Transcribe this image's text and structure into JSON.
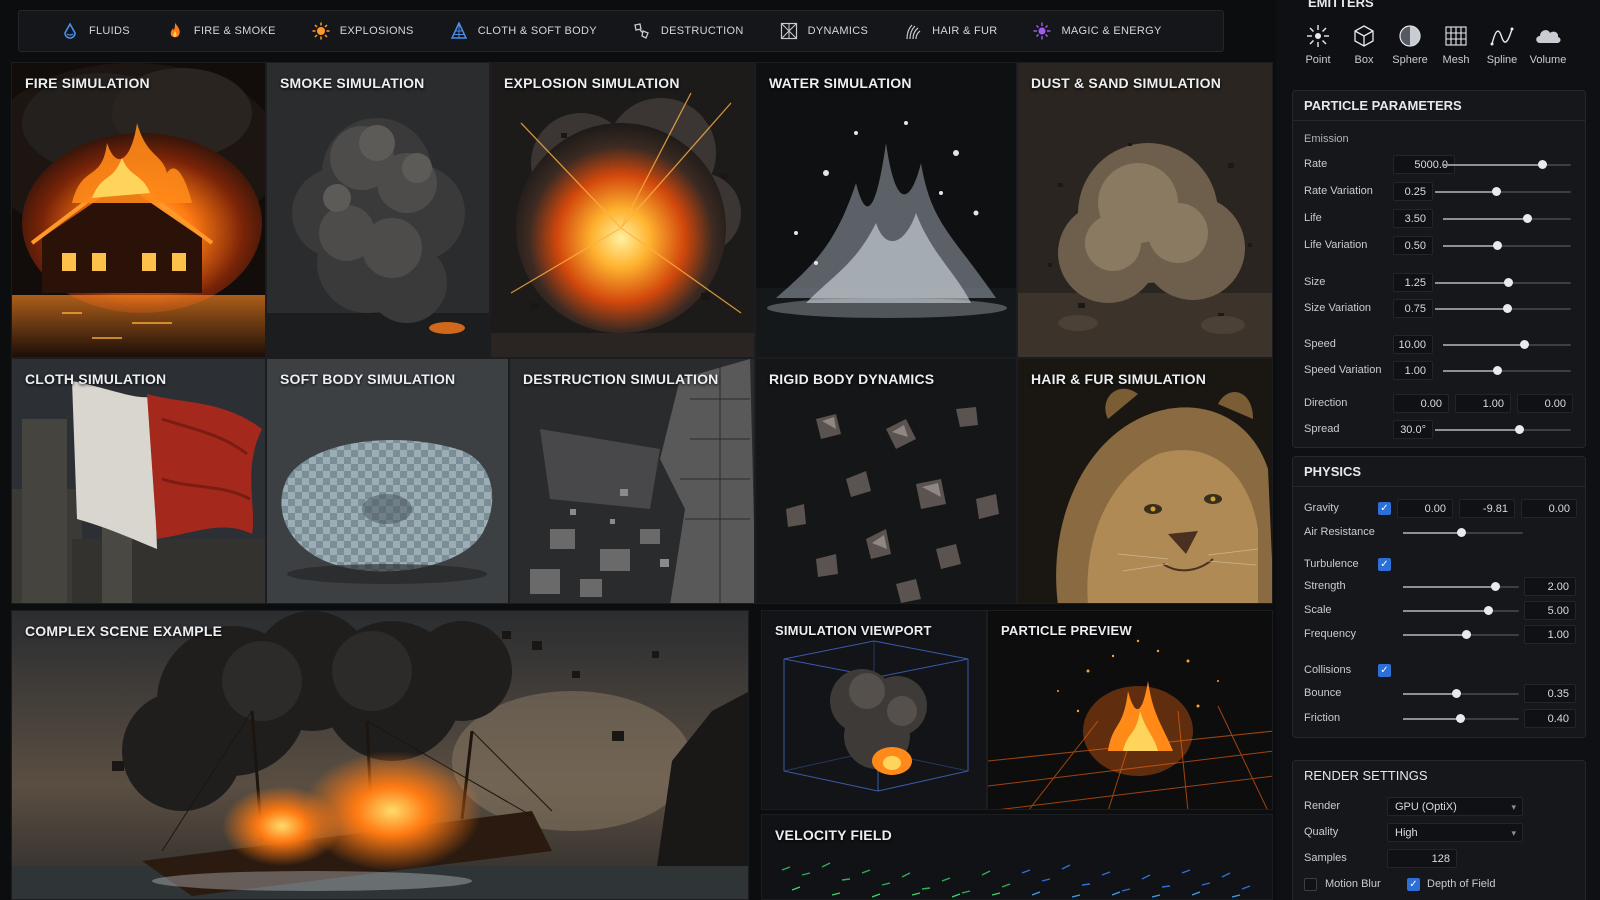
{
  "categories": [
    {
      "icon": "droplet-icon",
      "label": "FLUIDS"
    },
    {
      "icon": "flame-icon",
      "label": "FIRE & SMOKE"
    },
    {
      "icon": "burst-icon",
      "label": "EXPLOSIONS"
    },
    {
      "icon": "cloth-icon",
      "label": "CLOTH & SOFT BODY"
    },
    {
      "icon": "debris-icon",
      "label": "DESTRUCTION"
    },
    {
      "icon": "dynamics-icon",
      "label": "DYNAMICS"
    },
    {
      "icon": "fur-icon",
      "label": "HAIR & FUR"
    },
    {
      "icon": "sparkle-icon",
      "label": "MAGIC & ENERGY"
    }
  ],
  "tiles": {
    "fire": "FIRE SIMULATION",
    "smoke": "SMOKE SIMULATION",
    "explosion": "EXPLOSION SIMULATION",
    "water": "WATER SIMULATION",
    "dust": "DUST & SAND SIMULATION",
    "cloth": "CLOTH SIMULATION",
    "softbody": "SOFT BODY SIMULATION",
    "destruction": "DESTRUCTION SIMULATION",
    "rigid": "RIGID BODY DYNAMICS",
    "hair": "HAIR & FUR SIMULATION",
    "complex": "COMPLEX SCENE EXAMPLE",
    "viewport": "SIMULATION VIEWPORT",
    "preview": "PARTICLE PREVIEW",
    "velocity": "VELOCITY FIELD"
  },
  "emitters": {
    "title": "EMITTERS",
    "items": [
      {
        "icon": "point-emitter-icon",
        "label": "Point"
      },
      {
        "icon": "box-emitter-icon",
        "label": "Box"
      },
      {
        "icon": "sphere-emitter-icon",
        "label": "Sphere"
      },
      {
        "icon": "mesh-emitter-icon",
        "label": "Mesh"
      },
      {
        "icon": "spline-emitter-icon",
        "label": "Spline"
      },
      {
        "icon": "volume-emitter-icon",
        "label": "Volume"
      }
    ]
  },
  "particle_params": {
    "title": "PARTICLE PARAMETERS",
    "group": "Emission",
    "rate": {
      "label": "Rate",
      "value": "5000.0",
      "level": 0.77
    },
    "rate_variation": {
      "label": "Rate Variation",
      "value": "0.25",
      "level": 0.45
    },
    "life": {
      "label": "Life",
      "value": "3.50",
      "level": 0.66
    },
    "life_variation": {
      "label": "Life Variation",
      "value": "0.50",
      "level": 0.42
    },
    "size": {
      "label": "Size",
      "value": "1.25",
      "level": 0.54
    },
    "size_variation": {
      "label": "Size Variation",
      "value": "0.75",
      "level": 0.53
    },
    "speed": {
      "label": "Speed",
      "value": "10.00",
      "level": 0.63
    },
    "speed_variation": {
      "label": "Speed Variation",
      "value": "1.00",
      "level": 0.42
    },
    "direction": {
      "label": "Direction",
      "x": "0.00",
      "y": "1.00",
      "z": "0.00"
    },
    "spread": {
      "label": "Spread",
      "value": "30.0°",
      "level": 0.62
    }
  },
  "physics": {
    "title": "PHYSICS",
    "gravity": {
      "label": "Gravity",
      "enabled": "✓",
      "x": "0.00",
      "y": "-9.81",
      "z": "0.00"
    },
    "air_resistance": {
      "label": "Air Resistance",
      "level": 0.48
    },
    "turbulence": {
      "label": "Turbulence",
      "enabled": "✓"
    },
    "strength": {
      "label": "Strength",
      "value": "2.00",
      "level": 0.79
    },
    "scale": {
      "label": "Scale",
      "value": "5.00",
      "level": 0.73
    },
    "frequency": {
      "label": "Frequency",
      "value": "1.00",
      "level": 0.54
    },
    "collisions": {
      "label": "Collisions",
      "enabled": "✓"
    },
    "bounce": {
      "label": "Bounce",
      "value": "0.35",
      "level": 0.46
    },
    "friction": {
      "label": "Friction",
      "value": "0.40",
      "level": 0.49
    }
  },
  "render_settings": {
    "title": "RENDER SETTINGS",
    "render": {
      "label": "Render",
      "value": "GPU (OptiX)"
    },
    "quality": {
      "label": "Quality",
      "value": "High"
    },
    "samples": {
      "label": "Samples",
      "value": "128"
    },
    "motion_blur": {
      "label": "Motion Blur"
    },
    "depth_of_field": {
      "label": "Depth of Field",
      "enabled": "✓"
    }
  },
  "colors": {
    "accent": "#2c6fd6",
    "fire": "#ff7a1a",
    "panel": "#15171b"
  }
}
